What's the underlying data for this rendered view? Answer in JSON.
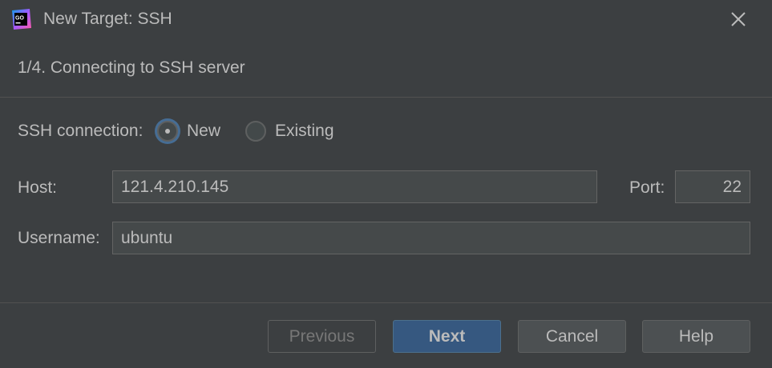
{
  "window": {
    "title": "New Target: SSH",
    "app_icon_text": "GO"
  },
  "step": {
    "text": "1/4. Connecting to SSH server"
  },
  "connection": {
    "label": "SSH connection:",
    "options": [
      {
        "label": "New",
        "selected": true
      },
      {
        "label": "Existing",
        "selected": false
      }
    ]
  },
  "fields": {
    "host_label": "Host:",
    "host_value": "121.4.210.145",
    "port_label": "Port:",
    "port_value": "22",
    "username_label": "Username:",
    "username_value": "ubuntu"
  },
  "buttons": {
    "previous": "Previous",
    "next": "Next",
    "cancel": "Cancel",
    "help": "Help"
  },
  "colors": {
    "background": "#3c3f41",
    "text": "#bbbbbb",
    "primary_button": "#365880",
    "focus_ring": "#466d94",
    "input_background": "#45494a"
  }
}
